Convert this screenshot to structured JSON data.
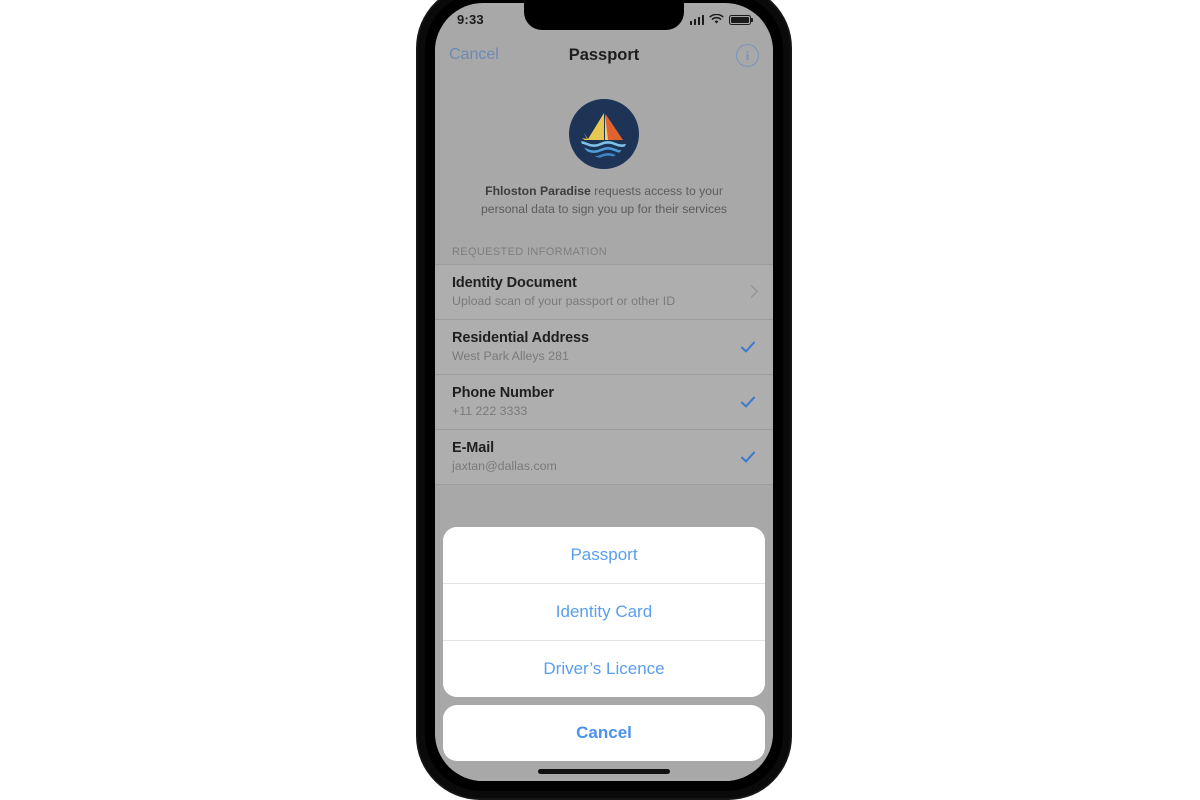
{
  "status_bar": {
    "time": "9:33",
    "signal_icon": "cellular-signal-icon",
    "wifi_icon": "wifi-icon",
    "battery_icon": "battery-icon"
  },
  "nav_bar": {
    "cancel_label": "Cancel",
    "title": "Passport",
    "info_label": "i",
    "info_icon": "info-circle-icon"
  },
  "hero": {
    "logo_icon": "fhloston-paradise-logo",
    "app_name": "Fhloston Paradise",
    "description": " requests access to your personal data to sign you up for their services"
  },
  "section": {
    "header": "REQUESTED INFORMATION"
  },
  "rows": [
    {
      "title": "Identity Document",
      "subtitle": "Upload scan of your passport or other ID",
      "accessory": "chevron",
      "name": "row-identity-document"
    },
    {
      "title": "Residential Address",
      "subtitle": "West Park Alleys 281",
      "accessory": "check",
      "name": "row-residential-address"
    },
    {
      "title": "Phone Number",
      "subtitle": "+11 222 3333",
      "accessory": "check",
      "name": "row-phone-number"
    },
    {
      "title": "E-Mail",
      "subtitle": "jaxtan@dallas.com",
      "accessory": "check",
      "name": "row-email"
    }
  ],
  "action_sheet": {
    "options": [
      {
        "label": "Passport",
        "name": "action-passport"
      },
      {
        "label": "Identity Card",
        "name": "action-identity-card"
      },
      {
        "label": "Driver’s Licence",
        "name": "action-drivers-licence"
      }
    ],
    "cancel_label": "Cancel"
  },
  "colors": {
    "accent_blue": "#5a9ef0",
    "nav_blue": "#6d89b5",
    "check_blue": "#3d7bd0",
    "screen_bg": "#a8a8a8",
    "sheet_white": "#ffffff",
    "logo_navy": "#1d3456",
    "logo_yellow": "#e8c752",
    "logo_orange": "#e0622f",
    "logo_wave": "#4f9dd6"
  }
}
